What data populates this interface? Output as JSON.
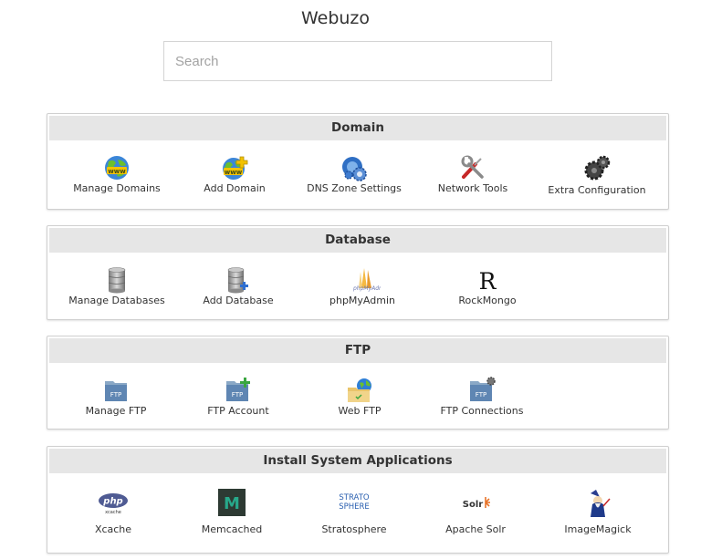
{
  "app_title": "Webuzo",
  "search": {
    "placeholder": "Search",
    "value": ""
  },
  "sections": [
    {
      "title": "Domain",
      "items": [
        {
          "label": "Manage Domains",
          "icon": "globe-www-icon"
        },
        {
          "label": "Add Domain",
          "icon": "globe-www-add-icon"
        },
        {
          "label": "DNS Zone Settings",
          "icon": "dns-gears-icon"
        },
        {
          "label": "Network Tools",
          "icon": "wrench-screwdriver-icon"
        },
        {
          "label": "Extra Configuration",
          "icon": "dark-gear-icon"
        }
      ]
    },
    {
      "title": "Database",
      "items": [
        {
          "label": "Manage Databases",
          "icon": "database-icon"
        },
        {
          "label": "Add Database",
          "icon": "database-add-icon"
        },
        {
          "label": "phpMyAdmin",
          "icon": "phpmyadmin-logo-icon",
          "logo_text": "phpMyAdmin"
        },
        {
          "label": "RockMongo",
          "icon": "rockmongo-logo-icon",
          "logo_text": "R"
        }
      ]
    },
    {
      "title": "FTP",
      "items": [
        {
          "label": "Manage FTP",
          "icon": "ftp-folder-icon",
          "logo_text": "FTP"
        },
        {
          "label": "FTP Account",
          "icon": "ftp-folder-add-icon",
          "logo_text": "FTP"
        },
        {
          "label": "Web FTP",
          "icon": "web-ftp-folder-icon"
        },
        {
          "label": "FTP Connections",
          "icon": "ftp-folder-gear-icon",
          "logo_text": "FTP"
        }
      ]
    },
    {
      "title": "Install System Applications",
      "items": [
        {
          "label": "Xcache",
          "icon": "xcache-logo-icon",
          "logo_text": "php",
          "logo_subtext": "xcache"
        },
        {
          "label": "Memcached",
          "icon": "memcached-logo-icon",
          "logo_text": "M"
        },
        {
          "label": "Stratosphere",
          "icon": "stratosphere-logo-icon",
          "logo_text": "STRATO",
          "logo_subtext": "SPHERE"
        },
        {
          "label": "Apache Solr",
          "icon": "solr-logo-icon",
          "logo_text": "Solr"
        },
        {
          "label": "ImageMagick",
          "icon": "imagemagick-wizard-icon"
        }
      ]
    }
  ],
  "colors": {
    "header_bg": "#e6e6e6",
    "panel_border": "#d0d0d0",
    "globe_green": "#5aa02c",
    "globe_blue": "#2f7fd6",
    "www_yellow": "#f2c200"
  }
}
